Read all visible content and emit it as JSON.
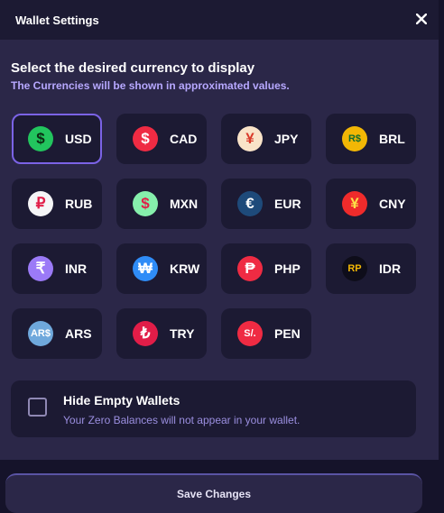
{
  "header": {
    "title": "Wallet Settings"
  },
  "section": {
    "heading": "Select the desired currency to display",
    "subheading": "The Currencies will be shown in approximated values."
  },
  "currencies": [
    {
      "code": "USD",
      "symbol": "$",
      "color": "#22c55e",
      "text_color": "#0b2a12",
      "selected": true
    },
    {
      "code": "CAD",
      "symbol": "$",
      "color": "#ef2b43",
      "text_color": "#ffffff",
      "selected": false
    },
    {
      "code": "JPY",
      "symbol": "¥",
      "color": "#f9e3c8",
      "text_color": "#d93a2a",
      "selected": false
    },
    {
      "code": "BRL",
      "symbol": "R$",
      "color": "#f2b705",
      "text_color": "#0f6b2e",
      "selected": false
    },
    {
      "code": "RUB",
      "symbol": "₽",
      "color": "#f5f5f7",
      "text_color": "#e11d48",
      "selected": false
    },
    {
      "code": "MXN",
      "symbol": "$",
      "color": "#86efac",
      "text_color": "#e11d48",
      "selected": false
    },
    {
      "code": "EUR",
      "symbol": "€",
      "color": "#1e4a7a",
      "text_color": "#ffffff",
      "selected": false
    },
    {
      "code": "CNY",
      "symbol": "¥",
      "color": "#ef2b2b",
      "text_color": "#fde047",
      "selected": false
    },
    {
      "code": "INR",
      "symbol": "₹",
      "color": "#9b7af7",
      "text_color": "#ffffff",
      "selected": false
    },
    {
      "code": "KRW",
      "symbol": "₩",
      "color": "#2f8cf7",
      "text_color": "#ffffff",
      "selected": false
    },
    {
      "code": "PHP",
      "symbol": "₱",
      "color": "#ef2b43",
      "text_color": "#ffffff",
      "selected": false
    },
    {
      "code": "IDR",
      "symbol": "RP",
      "color": "#0e0d1a",
      "text_color": "#f2b705",
      "selected": false
    },
    {
      "code": "ARS",
      "symbol": "AR$",
      "color": "#6fa8dc",
      "text_color": "#ffffff",
      "selected": false
    },
    {
      "code": "TRY",
      "symbol": "₺",
      "color": "#e11d48",
      "text_color": "#ffffff",
      "selected": false
    },
    {
      "code": "PEN",
      "symbol": "S/.",
      "color": "#ef2b43",
      "text_color": "#ffffff",
      "selected": false
    }
  ],
  "option": {
    "title": "Hide Empty Wallets",
    "description": "Your Zero Balances will not appear in your wallet.",
    "checked": false
  },
  "footer": {
    "save_label": "Save Changes"
  }
}
